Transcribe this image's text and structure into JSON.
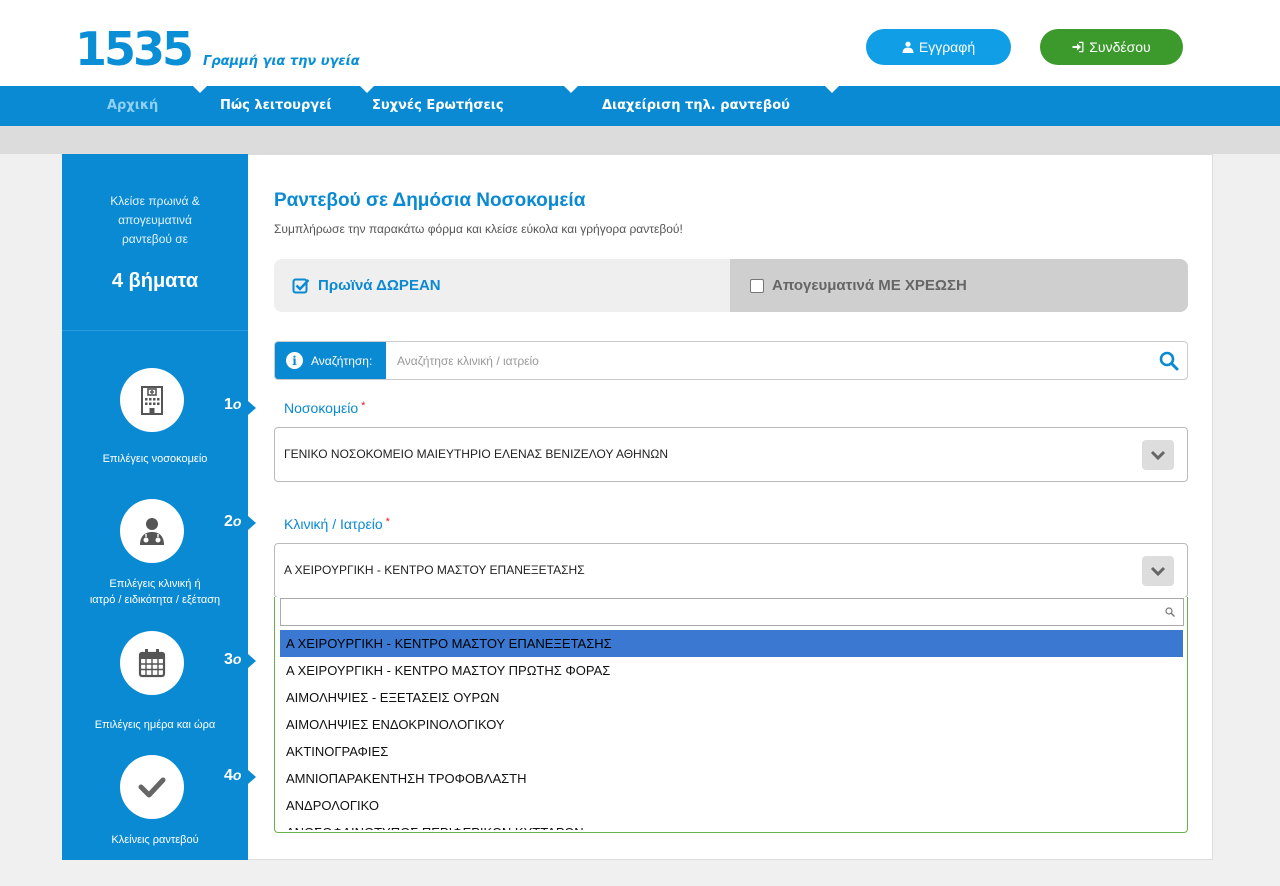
{
  "header": {
    "logo_number": "1535",
    "logo_text": "Γραμμή για την υγεία",
    "register_label": "Εγγραφή",
    "login_label": "Συνδέσου"
  },
  "nav": {
    "items": [
      {
        "label": "Αρχική"
      },
      {
        "label": "Πώς λειτουργεί"
      },
      {
        "label": "Συχνές Ερωτήσεις"
      },
      {
        "label": "Διαχείριση τηλ. ραντεβού"
      }
    ]
  },
  "sidebar": {
    "intro_line1": "Κλείσε πρωινά &",
    "intro_line2": "απογευματινά",
    "intro_line3": "ραντεβού σε",
    "title": "4 βήματα",
    "steps": [
      {
        "num": "1",
        "suffix": "ο",
        "label": "Επιλέγεις νοσοκομείο",
        "label2": "",
        "icon": "hospital-icon"
      },
      {
        "num": "2",
        "suffix": "ο",
        "label": "Επιλέγεις κλινική ή",
        "label2": "ιατρό / ειδικότητα / εξέταση",
        "icon": "doctor-icon"
      },
      {
        "num": "3",
        "suffix": "ο",
        "label": "Επιλέγεις ημέρα και ώρα",
        "label2": "",
        "icon": "calendar-icon"
      },
      {
        "num": "4",
        "suffix": "ο",
        "label": "Κλείνεις ραντεβού",
        "label2": "",
        "icon": "check-icon"
      }
    ]
  },
  "main": {
    "title": "Ραντεβού σε Δημόσια Νοσοκομεία",
    "subtitle": "Συμπλήρωσε την παρακάτω φόρμα και κλείσε εύκολα και γρήγορα ραντεβού!",
    "toggle": {
      "morning_label": "Πρωϊνά ΔΩΡΕΑΝ",
      "evening_label": "Απογευματινά ΜΕ ΧΡΕΩΣΗ",
      "morning_checked": true,
      "evening_checked": false
    },
    "search": {
      "tag_label": "Αναζήτηση:",
      "placeholder": "Αναζήτησε κλινική / ιατρείο",
      "value": ""
    },
    "hospital": {
      "label": "Νοσοκομείο",
      "required_mark": "*",
      "value": "ΓΕΝΙΚΟ ΝΟΣΟΚΟΜΕΙΟ ΜΑΙΕΥΤΗΡΙΟ ΕΛΕΝΑΣ ΒΕΝΙΖΕΛΟΥ ΑΘΗΝΩΝ"
    },
    "clinic": {
      "label": "Κλινική / Ιατρείο",
      "required_mark": "*",
      "value": "Α ΧΕΙΡΟΥΡΓΙΚΗ - ΚΕΝΤΡΟ ΜΑΣΤΟΥ ΕΠΑΝΕΞΕΤΑΣΗΣ",
      "dropdown_search_value": "",
      "options": [
        "Α ΧΕΙΡΟΥΡΓΙΚΗ - ΚΕΝΤΡΟ ΜΑΣΤΟΥ ΕΠΑΝΕΞΕΤΑΣΗΣ",
        "Α ΧΕΙΡΟΥΡΓΙΚΗ - ΚΕΝΤΡΟ ΜΑΣΤΟΥ ΠΡΩΤΗΣ ΦΟΡΑΣ",
        "ΑΙΜΟΛΗΨΙΕΣ - ΕΞΕΤΑΣΕΙΣ ΟΥΡΩΝ",
        "ΑΙΜΟΛΗΨΙΕΣ ΕΝΔΟΚΡΙΝΟΛΟΓΙΚΟΥ",
        "ΑΚΤΙΝΟΓΡΑΦΙΕΣ",
        "ΑΜΝΙΟΠΑΡΑΚΕΝΤΗΣΗ ΤΡΟΦΟΒΛΑΣΤΗ",
        "ΑΝΔΡΟΛΟΓΙΚΟ",
        "ΑΝΟΣΟΦΑΙΝΟΤΥΠΟΣ ΠΕΡΙΦΕΡΙΚΩΝ ΚΥΤΤΑΡΩΝ"
      ],
      "selected_index": 0
    }
  },
  "colors": {
    "brand_blue": "#0a8ad2",
    "register_blue": "#109ee6",
    "login_green": "#3c9a2d",
    "selected_option": "#3a78d1",
    "dropdown_border": "#6ab04c",
    "required_red": "#e02020"
  }
}
